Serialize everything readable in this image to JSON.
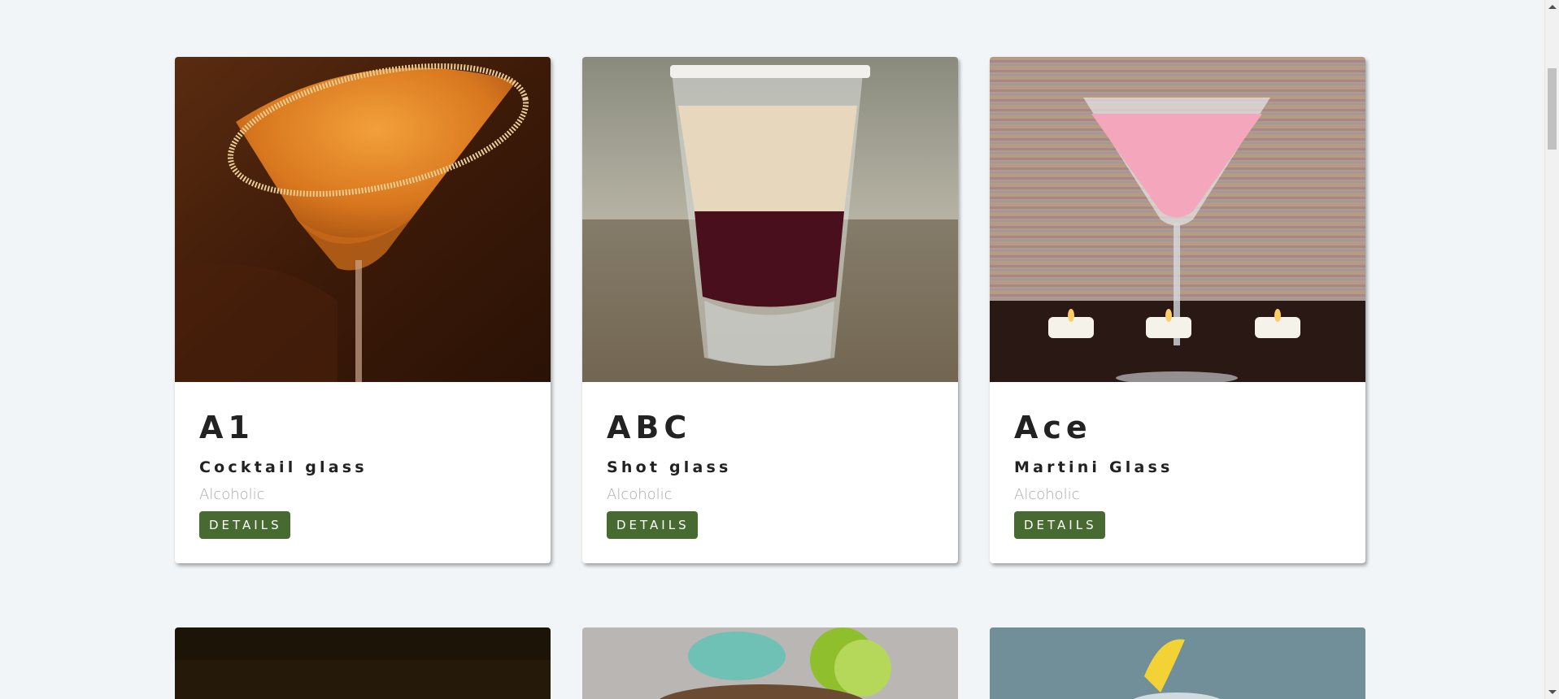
{
  "cards": [
    {
      "name": "A1",
      "glass": "Cocktail glass",
      "type": "Alcoholic",
      "button": "DETAILS"
    },
    {
      "name": "ABC",
      "glass": "Shot glass",
      "type": "Alcoholic",
      "button": "DETAILS"
    },
    {
      "name": "Ace",
      "glass": "Martini Glass",
      "type": "Alcoholic",
      "button": "DETAILS"
    }
  ],
  "colors": {
    "background": "#f1f5f8",
    "button": "#476a30",
    "title": "#222222",
    "muted": "#a8a8a8"
  }
}
